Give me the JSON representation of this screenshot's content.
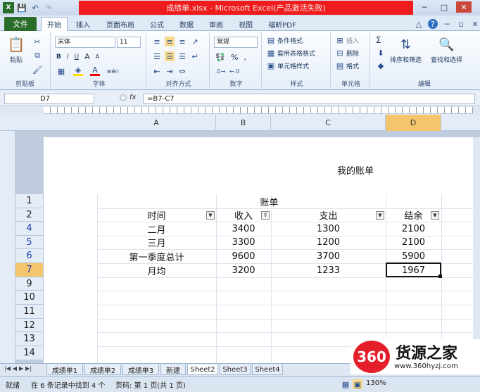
{
  "window": {
    "title": "成绩单.xlsx - Microsoft Excel(产品激活失败)",
    "min": "─",
    "max": "□",
    "close": "✕"
  },
  "qat": {
    "save_icon": "💾",
    "undo_icon": "↶",
    "redo_icon": "↷"
  },
  "tabs": {
    "file": "文件",
    "home": "开始",
    "insert": "插入",
    "layout": "页面布局",
    "formulas": "公式",
    "data": "数据",
    "review": "审阅",
    "view": "视图",
    "pdf": "福昕PDF"
  },
  "ribbon": {
    "clipboard": {
      "label": "剪贴板",
      "paste": "粘贴"
    },
    "font": {
      "label": "字体",
      "name": "宋体",
      "size": "11",
      "bold": "B",
      "italic": "I",
      "underline": "U",
      "grow": "A",
      "shrink": "A",
      "wen": "wén"
    },
    "align": {
      "label": "对齐方式"
    },
    "number": {
      "label": "数字",
      "format": "常规",
      "percent": "%",
      "comma": ","
    },
    "styles": {
      "label": "样式",
      "cond": "条件格式",
      "table": "套用表格格式",
      "cell": "单元格样式"
    },
    "cells": {
      "label": "单元格",
      "insert": "插入",
      "delete": "删除",
      "format": "格式"
    },
    "edit": {
      "label": "编辑",
      "sigma": "Σ",
      "sort": "排序和筛选",
      "find": "查找和选择"
    }
  },
  "formula_bar": {
    "name_box": "D7",
    "fx": "fx",
    "formula": "=B7-C7"
  },
  "columns": [
    "A",
    "B",
    "C",
    "D"
  ],
  "rows": [
    "1",
    "2",
    "4",
    "5",
    "6",
    "7",
    "9",
    "10",
    "11",
    "12",
    "13",
    "14"
  ],
  "header_text": "我的账单",
  "table": {
    "title": "账单",
    "headers": [
      "时间",
      "收入",
      "支出",
      "结余"
    ],
    "data": [
      [
        "二月",
        "3400",
        "1300",
        "2100"
      ],
      [
        "三月",
        "3300",
        "1200",
        "2100"
      ],
      [
        "第一季度总计",
        "9600",
        "3700",
        "5900"
      ],
      [
        "月均",
        "3200",
        "1233",
        "1967"
      ]
    ]
  },
  "sheets": [
    "成绩单1",
    "成绩单2",
    "成绩单3",
    "新建",
    "Sheet2",
    "Sheet3",
    "Sheet4"
  ],
  "status": {
    "ready": "就绪",
    "records": "在 6 条记录中找到 4 个",
    "page": "页码: 第 1 页(共 1 页)",
    "zoom": "130%"
  },
  "watermark": {
    "brand": "360",
    "name": "货源之家",
    "url": "www.360hyzj.com"
  },
  "colors": {
    "excel_green": "#2a6d2a",
    "title_red": "#ee1c1c",
    "ribbon_bg": "#e6eef9"
  }
}
